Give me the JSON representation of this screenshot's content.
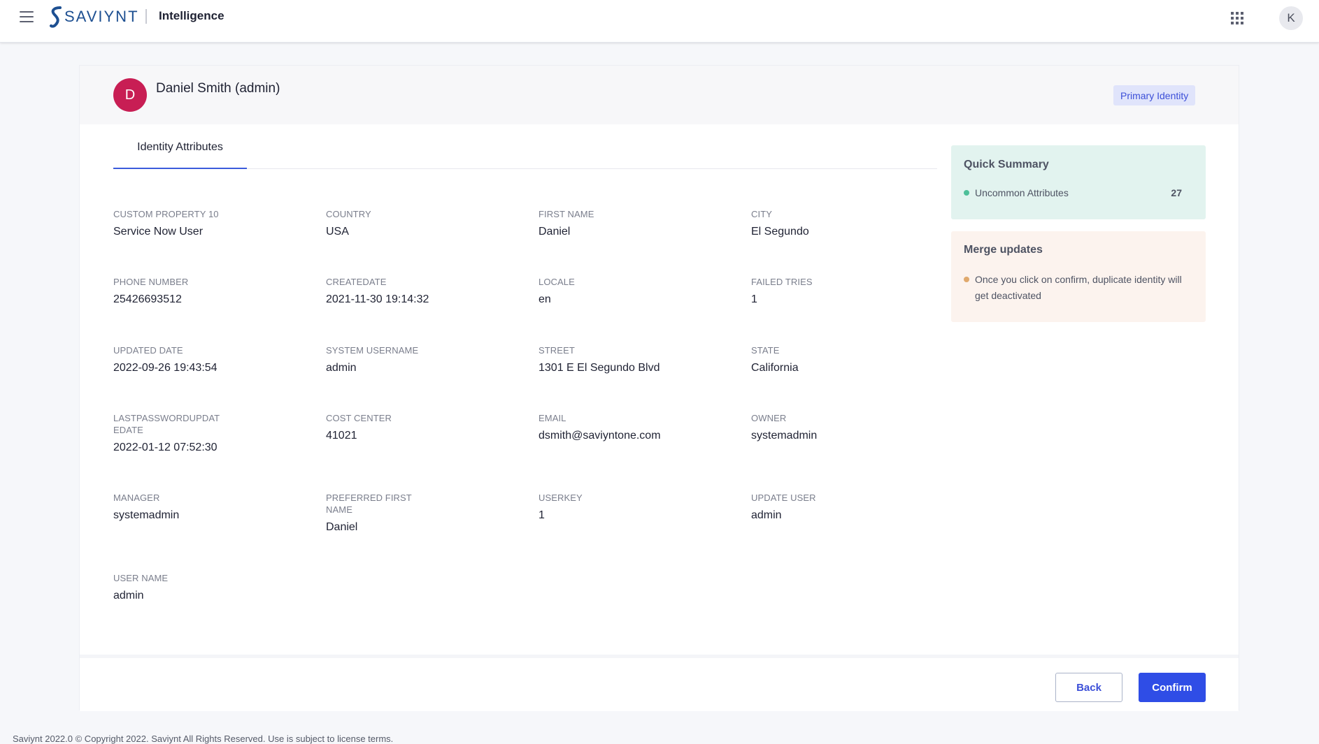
{
  "header": {
    "logo_text": "SAVIYNT",
    "product_name": "Intelligence",
    "user_initial": "K"
  },
  "identity": {
    "initial": "D",
    "name": "Daniel Smith (admin)",
    "badge": "Primary Identity"
  },
  "tabs": [
    {
      "label": "Identity Attributes",
      "active": true
    }
  ],
  "attributes": [
    {
      "label": "CUSTOM PROPERTY 10",
      "value": "Service Now User"
    },
    {
      "label": "COUNTRY",
      "value": "USA"
    },
    {
      "label": "FIRST NAME",
      "value": "Daniel"
    },
    {
      "label": "CITY",
      "value": "El Segundo"
    },
    {
      "label": "PHONE NUMBER",
      "value": "25426693512"
    },
    {
      "label": "CREATEDATE",
      "value": "2021-11-30 19:14:32"
    },
    {
      "label": "LOCALE",
      "value": "en"
    },
    {
      "label": "FAILED TRIES",
      "value": "1"
    },
    {
      "label": "UPDATED DATE",
      "value": "2022-09-26 19:43:54"
    },
    {
      "label": "SYSTEM USERNAME",
      "value": "admin"
    },
    {
      "label": "STREET",
      "value": "1301 E El Segundo Blvd"
    },
    {
      "label": "STATE",
      "value": "California"
    },
    {
      "label": "LASTPASSWORDUPDAT EDATE",
      "value": "2022-01-12 07:52:30"
    },
    {
      "label": "COST CENTER",
      "value": "41021"
    },
    {
      "label": "EMAIL",
      "value": "dsmith@saviyntone.com"
    },
    {
      "label": "OWNER",
      "value": "systemadmin"
    },
    {
      "label": "MANAGER",
      "value": "systemadmin"
    },
    {
      "label": "PREFERRED FIRST NAME",
      "value": "Daniel"
    },
    {
      "label": "USERKEY",
      "value": "1"
    },
    {
      "label": "UPDATE USER",
      "value": "admin"
    },
    {
      "label": "USER NAME",
      "value": "admin"
    }
  ],
  "quick_summary": {
    "title": "Quick Summary",
    "label": "Uncommon Attributes",
    "count": "27"
  },
  "merge_updates": {
    "title": "Merge updates",
    "message": "Once you click on confirm, duplicate identity will get deactivated"
  },
  "actions": {
    "back_label": "Back",
    "confirm_label": "Confirm"
  },
  "footer": {
    "copyright": "Saviynt 2022.0 © Copyright 2022. Saviynt All Rights Reserved. Use is subject to license terms."
  },
  "colors": {
    "accent": "#2f4de6",
    "avatar": "#c81e54",
    "summary_bg": "#e2f3ef",
    "summary_dot": "#4dbf99",
    "merge_bg": "#fcf3ee",
    "merge_dot": "#e0a96d"
  },
  "icons": {
    "menu": "hamburger-menu-icon",
    "apps": "apps-grid-icon",
    "logo": "saviynt-logo-icon"
  }
}
